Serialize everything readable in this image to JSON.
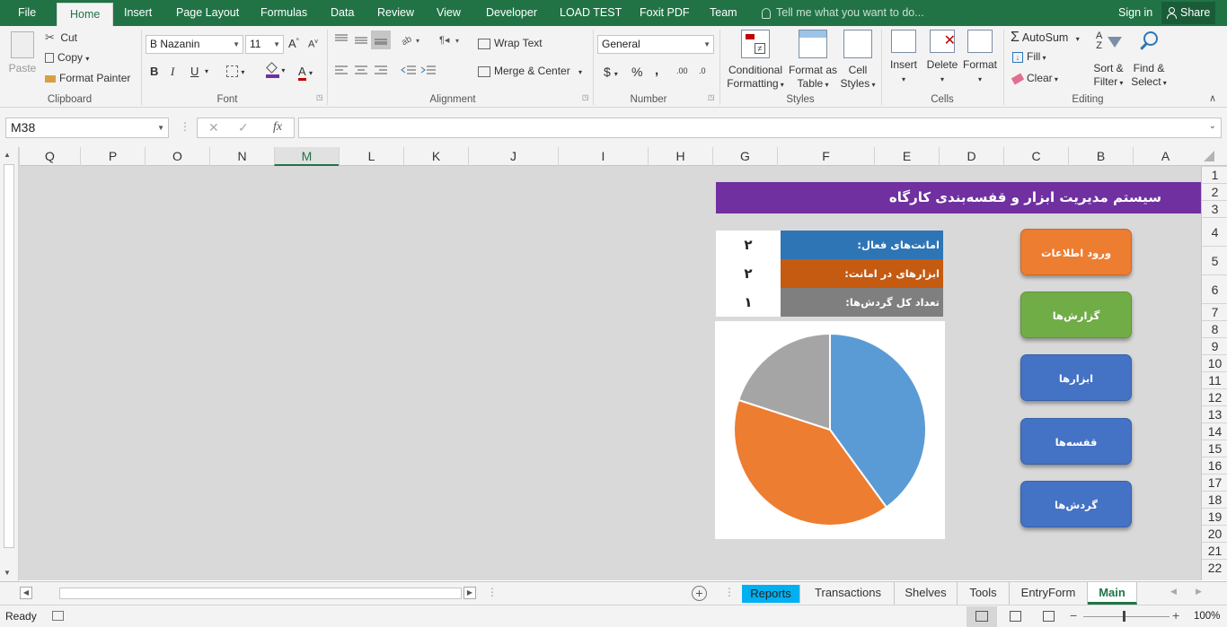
{
  "ribbon_tabs": [
    "File",
    "Home",
    "Insert",
    "Page Layout",
    "Formulas",
    "Data",
    "Review",
    "View",
    "Developer",
    "LOAD TEST",
    "Foxit PDF",
    "Team"
  ],
  "tell_me": "Tell me what you want to do...",
  "sign_in": "Sign in",
  "share": "Share",
  "clipboard": {
    "paste": "Paste",
    "cut": "Cut",
    "copy": "Copy",
    "format_painter": "Format Painter",
    "label": "Clipboard"
  },
  "font": {
    "name": "B Nazanin",
    "size": "11",
    "label": "Font",
    "bold": "B",
    "italic": "I",
    "underline": "U",
    "grow": "A",
    "shrink": "A",
    "color_a": "A"
  },
  "alignment": {
    "wrap_text": "Wrap Text",
    "merge_center": "Merge & Center",
    "label": "Alignment"
  },
  "number": {
    "format": "General",
    "currency": "$",
    "percent": "%",
    "comma": ",",
    "inc_dec": ".00",
    "label": "Number"
  },
  "styles": {
    "conditional": "Conditional",
    "formatting": "Formatting",
    "format_as": "Format as",
    "table": "Table",
    "cell": "Cell",
    "cell_styles": "Styles",
    "label": "Styles"
  },
  "cells": {
    "insert": "Insert",
    "delete": "Delete",
    "format": "Format",
    "label": "Cells"
  },
  "editing": {
    "autosum": "AutoSum",
    "fill": "Fill",
    "clear": "Clear",
    "sort": "Sort &",
    "filter": "Filter",
    "find": "Find &",
    "select": "Select",
    "label": "Editing"
  },
  "formula_bar": {
    "name_box": "M38",
    "fx": "fx",
    "formula": ""
  },
  "columns": [
    "Q",
    "P",
    "O",
    "N",
    "M",
    "L",
    "K",
    "J",
    "I",
    "H",
    "G",
    "F",
    "E",
    "D",
    "C",
    "B",
    "A"
  ],
  "selected_column": "M",
  "rows": [
    "1",
    "2",
    "3",
    "4",
    "5",
    "6",
    "7",
    "8",
    "9",
    "10",
    "11",
    "12",
    "13",
    "14",
    "15",
    "16",
    "17",
    "18",
    "19",
    "20",
    "21",
    "22"
  ],
  "sheet_title": "سیستم مدیریت ابزار و قفسه‌بندی کارگاه",
  "stats": [
    {
      "label": "امانت‌های فعال:",
      "value": "۲",
      "color": "#2e75b6"
    },
    {
      "label": "ابزارهای در امانت:",
      "value": "۲",
      "color": "#c55a11"
    },
    {
      "label": "تعداد کل گردش‌ها:",
      "value": "۱",
      "color": "#7f7f7f"
    }
  ],
  "nav_buttons": [
    {
      "label": "ورود اطلاعات",
      "color": "#ed7d31"
    },
    {
      "label": "گزارش‌ها",
      "color": "#70ad47"
    },
    {
      "label": "ابزارها",
      "color": "#4472c4"
    },
    {
      "label": "قفسه‌ها",
      "color": "#4472c4"
    },
    {
      "label": "گردش‌ها",
      "color": "#4472c4"
    }
  ],
  "chart_data": {
    "type": "pie",
    "values": [
      2,
      2,
      1
    ],
    "colors": [
      "#5b9bd5",
      "#ed7d31",
      "#a5a5a5"
    ],
    "title": ""
  },
  "sheet_tabs": [
    {
      "label": "Reports",
      "state": "colored"
    },
    {
      "label": "Transactions",
      "state": "normal"
    },
    {
      "label": "Shelves",
      "state": "normal"
    },
    {
      "label": "Tools",
      "state": "normal"
    },
    {
      "label": "EntryForm",
      "state": "normal"
    },
    {
      "label": "Main",
      "state": "active"
    }
  ],
  "status": {
    "ready": "Ready",
    "zoom": "100%"
  }
}
